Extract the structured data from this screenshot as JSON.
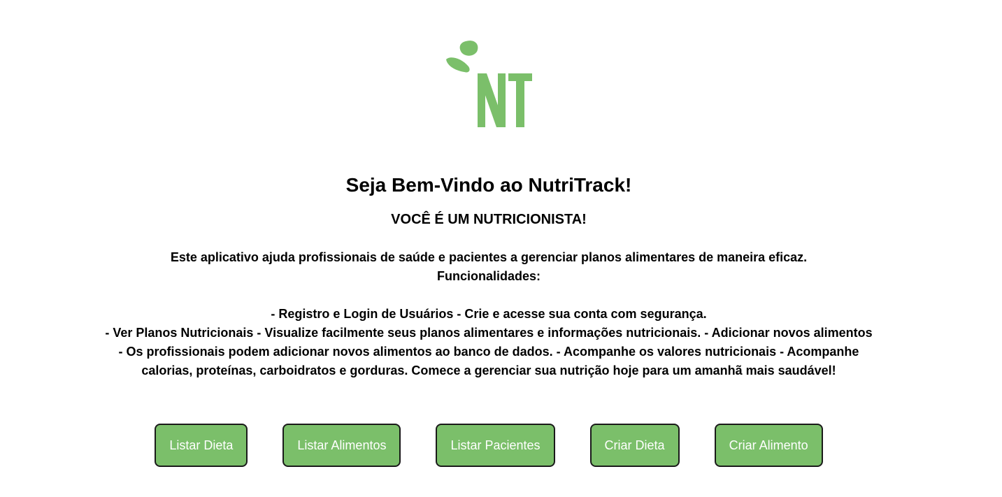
{
  "logo": {
    "icon": "leaf-icon",
    "letters": "NT",
    "color": "#7bbf6a"
  },
  "header": {
    "title": "Seja Bem-Vindo ao NutriTrack!",
    "subtitle": "VOCÊ É UM NUTRICIONISTA!"
  },
  "description": {
    "line1": "Este aplicativo ajuda profissionais de saúde e pacientes a gerenciar planos alimentares de maneira eficaz.",
    "line2": "Funcionalidades:",
    "line3": "- Registro e Login de Usuários - Crie e acesse sua conta com segurança.",
    "line4": "- Ver Planos Nutricionais - Visualize facilmente seus planos alimentares e informações nutricionais. - Adicionar novos alimentos",
    "line5": "- Os profissionais podem adicionar novos alimentos ao banco de dados. - Acompanhe os valores nutricionais - Acompanhe",
    "line6": "calorias, proteínas, carboidratos e gorduras. Comece a gerenciar sua nutrição hoje para um amanhã mais saudável!"
  },
  "actions": {
    "list_diet": "Listar Dieta",
    "list_foods": "Listar Alimentos",
    "list_patients": "Listar Pacientes",
    "create_diet": "Criar Dieta",
    "create_food": "Criar Alimento",
    "button_color": "#7bbf6a"
  }
}
